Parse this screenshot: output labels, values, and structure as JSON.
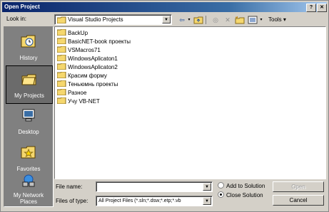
{
  "window": {
    "title": "Open Project"
  },
  "lookin": {
    "label": "Look in:",
    "value": "Visual Studio Projects"
  },
  "toolbar": {
    "tools_label": "Tools",
    "back_icon": "back-arrow-icon",
    "up_icon": "up-folder-icon"
  },
  "places": [
    {
      "label": "History",
      "icon": "history-icon"
    },
    {
      "label": "My Projects",
      "icon": "my-projects-icon"
    },
    {
      "label": "Desktop",
      "icon": "desktop-icon"
    },
    {
      "label": "Favorites",
      "icon": "favorites-icon"
    },
    {
      "label": "My Network Places",
      "icon": "network-icon"
    }
  ],
  "files": [
    "BackUp",
    "BasicNET-book проекты",
    "VSMacros71",
    "WindowsAplicaton1",
    "WindowsAplicaton2",
    "Красим форму",
    "Теньюмнь проекты",
    "Разное",
    "Учу VB-NET"
  ],
  "filename": {
    "label": "File name:",
    "value": ""
  },
  "filetype": {
    "label": "Files of type:",
    "value": "All Project Files (*.sln;*.dsw;*.etp;*.vb"
  },
  "options": {
    "add_label": "Add to Solution",
    "close_label": "Close Solution",
    "selected": "close"
  },
  "buttons": {
    "open": "Open",
    "cancel": "Cancel"
  },
  "colors": {
    "titlebar": "#0a246a",
    "folder": "#f5d76e"
  }
}
